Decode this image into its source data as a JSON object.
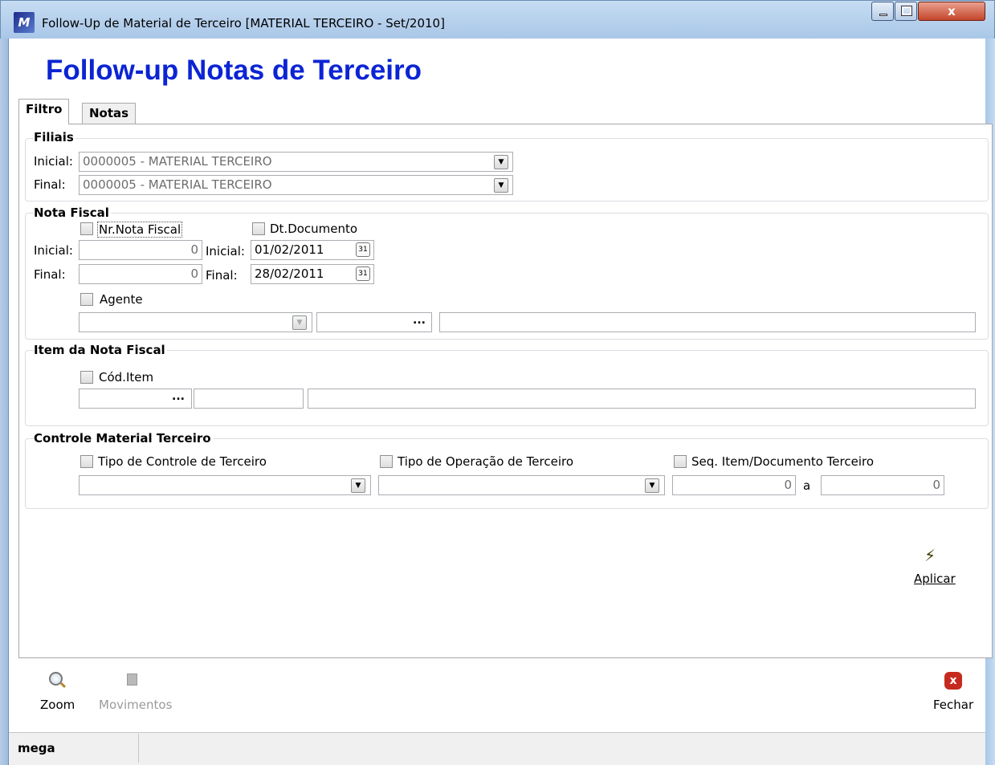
{
  "window": {
    "title": "Follow-Up de Material de Terceiro [MATERIAL TERCEIRO - Set/2010]",
    "close_glyph": "x"
  },
  "page_title": "Follow-up Notas de Terceiro",
  "tabs": [
    {
      "label": "Filtro",
      "active": true
    },
    {
      "label": "Notas",
      "active": false
    }
  ],
  "filiais": {
    "title": "Filiais",
    "inicial_label": "Inicial:",
    "inicial_value": "0000005 - MATERIAL TERCEIRO",
    "final_label": "Final:",
    "final_value": "0000005 - MATERIAL TERCEIRO"
  },
  "nota_fiscal": {
    "title": "Nota Fiscal",
    "nr_nota_label": "Nr.Nota Fiscal",
    "dt_documento_label": "Dt.Documento",
    "inicial_label": "Inicial:",
    "final_label": "Final:",
    "nr_inicial": "0",
    "nr_final": "0",
    "dt_inicial_label": "Inicial:",
    "dt_final_label": "Final:",
    "dt_inicial": "01/02/2011",
    "dt_final": "28/02/2011",
    "agente_label": "Agente",
    "ellipsis": "..."
  },
  "item": {
    "title": "Item da Nota Fiscal",
    "cod_item_label": "Cód.Item",
    "ellipsis": "..."
  },
  "controle": {
    "title": "Controle Material Terceiro",
    "tipo_controle_label": "Tipo de Controle de Terceiro",
    "tipo_operacao_label": "Tipo de Operação de Terceiro",
    "seq_label": "Seq. Item/Documento Terceiro",
    "seq_from": "0",
    "seq_sep": "a",
    "seq_to": "0"
  },
  "aplicar_label": "Aplicar",
  "toolbar": {
    "zoom_label": "Zoom",
    "movimentos_label": "Movimentos",
    "fechar_label": "Fechar"
  },
  "status": {
    "text": "mega"
  },
  "colors": {
    "title_blue": "#0b24d4",
    "close_red": "#c4452b"
  }
}
